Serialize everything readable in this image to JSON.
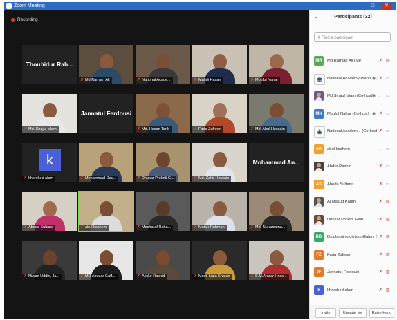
{
  "window": {
    "title": "Zoom Meeting"
  },
  "recording": {
    "label": "Recording"
  },
  "tiles": [
    {
      "name": "Thouhidur Rah...",
      "style": "name"
    },
    {
      "name": "Md Ramjan Ali",
      "style": "video",
      "bg": "#5b4e3f",
      "skin": "#8a5a3c",
      "shirt": "#2d4a66"
    },
    {
      "name": "National Acade...",
      "style": "video",
      "bg": "#6b5a4a",
      "skin": "#7a4f36",
      "shirt": "#3a3a3a"
    },
    {
      "name": "Mahdi Hasan",
      "style": "video",
      "bg": "#c9c2b4",
      "skin": "#8e5f42",
      "shirt": "#1f2d4a"
    },
    {
      "name": "Mouful Nahar",
      "style": "video",
      "bg": "#bfb6a8",
      "skin": "#9a6a4c",
      "shirt": "#7a2030"
    },
    {
      "name": "Md. Sirajul Islam",
      "style": "video",
      "bg": "#e4e2dc",
      "skin": "#8c5b3e",
      "shirt": "#e8e8e8"
    },
    {
      "name": "Jannatul Ferdousi",
      "style": "name"
    },
    {
      "name": "Md. Hasan Tarik",
      "style": "video",
      "bg": "#8a6a4a",
      "skin": "#7e5238",
      "shirt": "#3b5a7a"
    },
    {
      "name": "Faria Zafreen",
      "style": "video",
      "bg": "#d9d2c6",
      "skin": "#a0705a",
      "shirt": "#b04a2a"
    },
    {
      "name": "Md. Abul Hossain",
      "style": "video",
      "bg": "#7a7a6e",
      "skin": "#7a4e34",
      "shirt": "#4a6a8a"
    },
    {
      "name": "khorshed alam",
      "style": "avatar",
      "letter": "k"
    },
    {
      "name": "Mohammad Dau...",
      "style": "video",
      "bg": "#b9a27a",
      "skin": "#8a5a3a",
      "shirt": "#2a3a5a"
    },
    {
      "name": "Dhusar Prokriti G...",
      "style": "video",
      "bg": "#a9936e",
      "skin": "#6e4630",
      "shirt": "#4a5a7a"
    },
    {
      "name": "Md. Zakir Hossain",
      "style": "video",
      "bg": "#d8d4cc",
      "skin": "#8a5a40",
      "shirt": "#e0e6ee"
    },
    {
      "name": "Mohammad An...",
      "style": "name"
    },
    {
      "name": "Abeda Sultana",
      "style": "video",
      "bg": "#d6d0c4",
      "skin": "#a06a50",
      "shirt": "#c0306a"
    },
    {
      "name": "abul kashem",
      "style": "video",
      "bg": "#c2b08a",
      "skin": "#7a4e34",
      "shirt": "#dcdcdc",
      "highlight": true
    },
    {
      "name": "Mosharaf Raha...",
      "style": "video",
      "bg": "#5a5a5a",
      "skin": "#5a3a28",
      "shirt": "#2a2a2a"
    },
    {
      "name": "Matiur Rahman",
      "style": "video",
      "bg": "#b8b2a8",
      "skin": "#8a5a3e",
      "shirt": "#dde2ea"
    },
    {
      "name": "Md. Nuruzzama...",
      "style": "video",
      "bg": "#9a8a76",
      "skin": "#7a4e36",
      "shirt": "#2a2a2a"
    },
    {
      "name": "Nizam Uddin, Ja...",
      "style": "video",
      "bg": "#3a3a3a",
      "skin": "#6a4430",
      "shirt": "#222"
    },
    {
      "name": "MD Abuzar Gaff...",
      "style": "video",
      "bg": "#e6e6e6",
      "skin": "#7a4e34",
      "shirt": "#1e1e1e"
    },
    {
      "name": "Abdur Rashid",
      "style": "video",
      "bg": "#4a4a4a",
      "skin": "#7a4a30",
      "shirt": "#5a4a3a"
    },
    {
      "name": "Most. Lipia Khatun",
      "style": "video",
      "bg": "#2a2a2a",
      "skin": "#8a5a3a",
      "shirt": "#c89a3a"
    },
    {
      "name": "S.M.Anwar Hoss...",
      "style": "video",
      "bg": "#c9c5bd",
      "skin": "#8a5a40",
      "shirt": "#b03030"
    }
  ],
  "participants_panel": {
    "title": "Participants (32)",
    "search_placeholder": "Find a participant",
    "list": [
      {
        "initials": "MR",
        "color": "#5aa85a",
        "name": "Md Ramjan Ali (Me)",
        "mic": "off",
        "cam": "off"
      },
      {
        "initials": "",
        "color": "#ffffff",
        "emblem": true,
        "name": "National Academy Plann... (Host)",
        "mic": "off",
        "cam": "on",
        "share": true
      },
      {
        "initials": "",
        "color": "#6a5a8a",
        "photo": true,
        "name": "Md Sirajul Islam (Co-host)",
        "mic": "on",
        "cam": "on",
        "share": true
      },
      {
        "initials": "MN",
        "color": "#3a7ac9",
        "name": "Mouful Nahar (Co-host)",
        "mic": "off",
        "cam": "on",
        "share": true
      },
      {
        "initials": "",
        "color": "#ffffff",
        "emblem": true,
        "name": "National Academ... (Co-host)",
        "mic": "off",
        "cam": "on"
      },
      {
        "initials": "AK",
        "color": "#f0a030",
        "name": "abul kashem",
        "mic": "on",
        "cam": "on"
      },
      {
        "initials": "",
        "color": "#444444",
        "photo": true,
        "name": "Abdur Rashid",
        "mic": "off",
        "cam": "on"
      },
      {
        "initials": "AS",
        "color": "#f0a030",
        "name": "Abeda Sultana",
        "mic": "off",
        "cam": "on"
      },
      {
        "initials": "",
        "color": "#555555",
        "photo": true,
        "name": "Al Masud Karim",
        "mic": "off",
        "cam": "off"
      },
      {
        "initials": "",
        "color": "#6a4a3a",
        "photo": true,
        "name": "Dhusar Prokriti Gain",
        "mic": "off",
        "cam": "off"
      },
      {
        "initials": "DD",
        "color": "#3aa86a",
        "name": "Ds.planning divisionGalary (C...",
        "mic": "off",
        "cam": "off"
      },
      {
        "initials": "FZ",
        "color": "#e07a2a",
        "name": "Faria Zafreen",
        "mic": "off",
        "cam": "off"
      },
      {
        "initials": "JF",
        "color": "#e07a2a",
        "name": "Jannatul Ferdousi",
        "mic": "off",
        "cam": "off"
      },
      {
        "initials": "k",
        "color": "#4b60d6",
        "name": "khorshed alam",
        "mic": "off",
        "cam": "off"
      }
    ],
    "footer": {
      "invite": "Invite",
      "unmute": "Unmute Me",
      "raise": "Raise Hand"
    }
  }
}
